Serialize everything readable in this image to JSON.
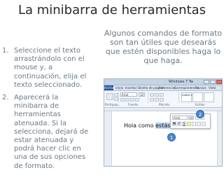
{
  "slide": {
    "title": "La minibarra de herramientas",
    "subtitle": "Algunos comandos de formato son tan útiles que desearás que estén disponibles haga lo que haga.",
    "steps": [
      {
        "number": "1.",
        "text": "Seleccione el texto arrastrándolo con el mouse y, a continuación, elija el texto seleccionado."
      },
      {
        "number": "2.",
        "text": "Aparecerá la minibarra de herramientas atenuada. Si la selecciona, dejará de estar atenuada y podrá hacer clic en una de sus opciones de formato."
      }
    ]
  },
  "screenshot": {
    "window_title": "Windows 7 Tw",
    "tabs": [
      "Archivo",
      "Inicio",
      "Insertar",
      "Diseño de página",
      "Referencias",
      "Correspondencia",
      "Revisar",
      "Vista"
    ],
    "ribbon": {
      "font": "Arial",
      "size": "10",
      "style_sample": "AaBbCcDc",
      "groups": [
        "Portapap...",
        "Fuente",
        "Párrafo",
        "Estilos"
      ]
    },
    "document": {
      "text_before": "Hola como ",
      "text_selected": "estás"
    },
    "minibar": {
      "font": "Arial",
      "size": "10",
      "buttons": [
        "N",
        "K",
        "S"
      ]
    },
    "callouts": [
      "1",
      "2"
    ],
    "colors": {
      "accent": "#4a86c8",
      "selection": "#b9d3ef",
      "file_tab": "#2b579a"
    }
  }
}
